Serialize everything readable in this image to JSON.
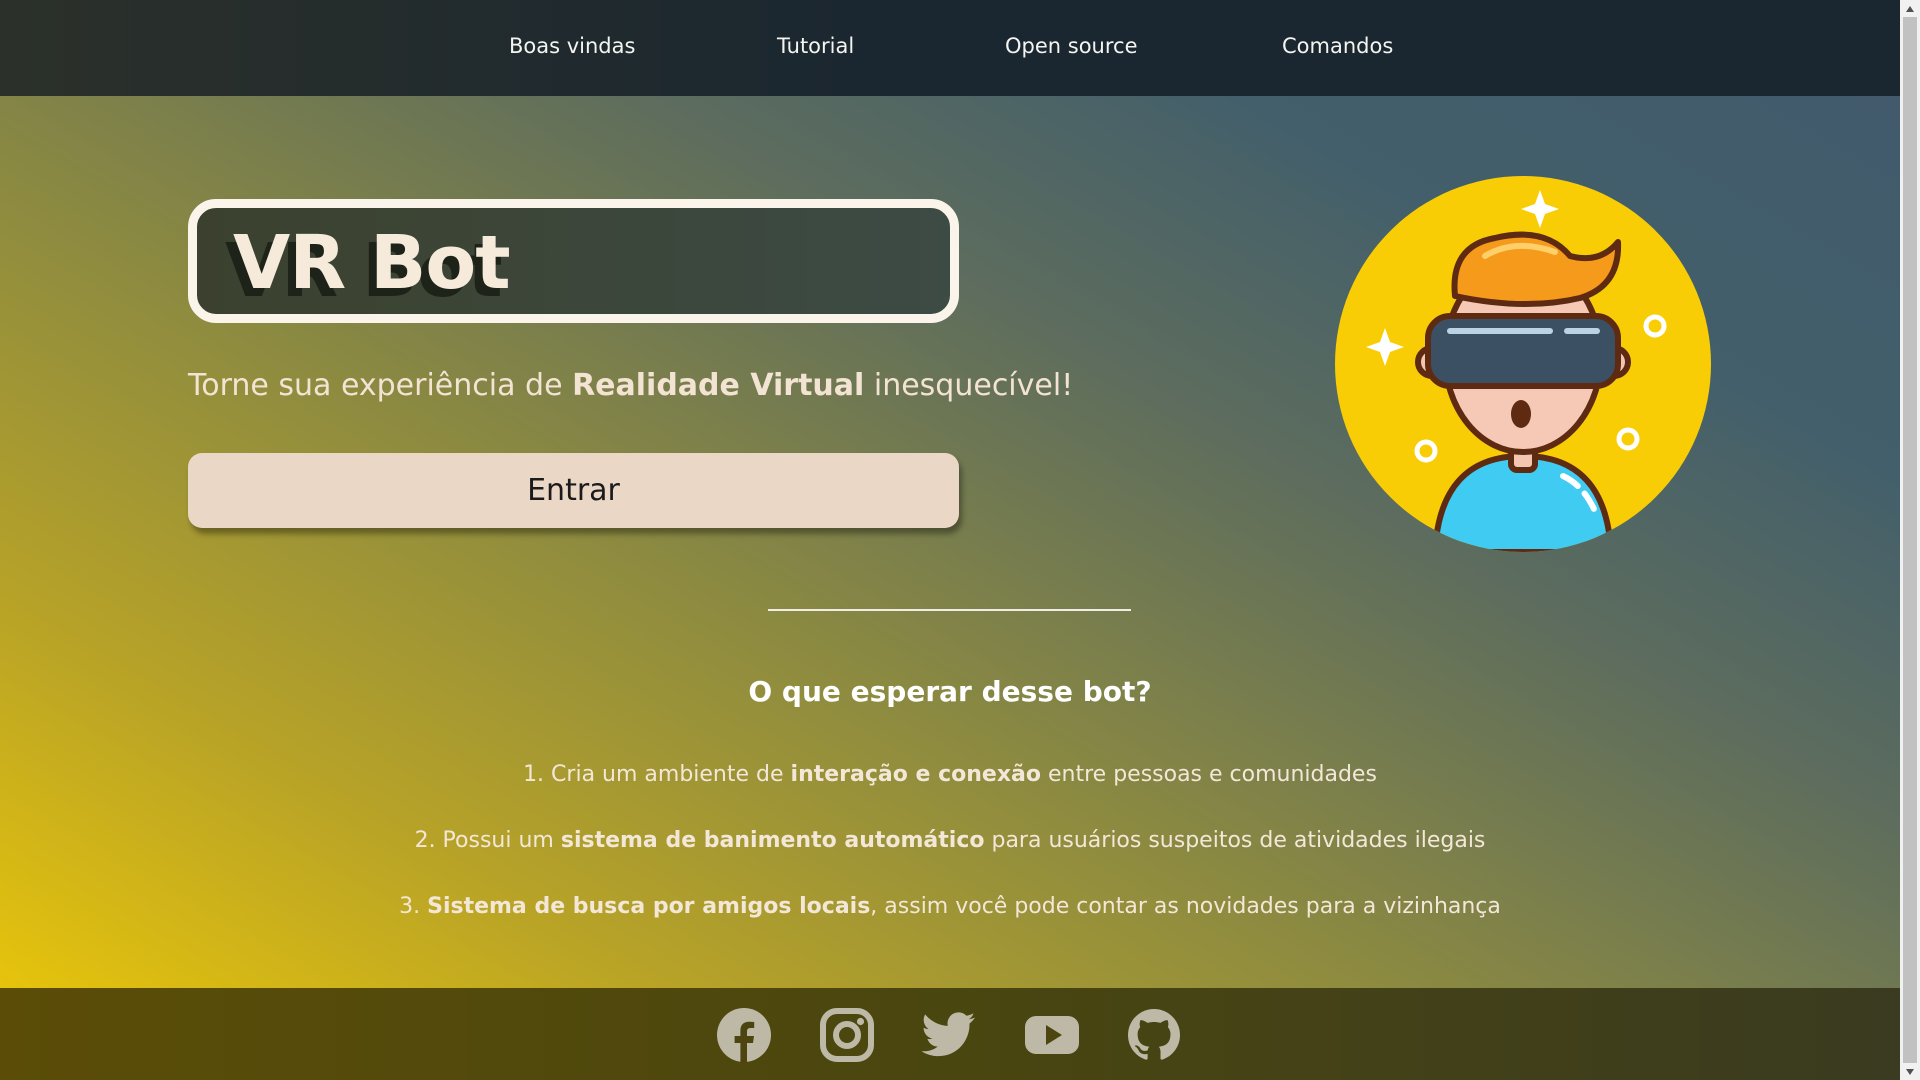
{
  "nav": {
    "items": [
      {
        "label": "Boas vindas"
      },
      {
        "label": "Tutorial"
      },
      {
        "label": "Open source"
      },
      {
        "label": "Comandos"
      }
    ]
  },
  "hero": {
    "title": "VR Bot",
    "subtitle_pre": "Torne sua experiência de ",
    "subtitle_bold": "Realidade Virtual",
    "subtitle_post": " inesquecível!",
    "button_label": "Entrar",
    "illustration_icon": "vr-headset-person-icon"
  },
  "features": {
    "title": "O que esperar desse bot?",
    "items": [
      {
        "pre": "1. Cria um ambiente de ",
        "bold": "interação e conexão",
        "post": " entre pessoas e comunidades"
      },
      {
        "pre": "2. Possui um ",
        "bold": "sistema de banimento automático",
        "post": " para usuários suspeitos de atividades ilegais"
      },
      {
        "pre": "3. ",
        "bold": "Sistema de busca por amigos locais",
        "post": ", assim você pode contar as novidades para a vizinhança"
      }
    ]
  },
  "footer": {
    "social": [
      {
        "icon": "facebook-icon"
      },
      {
        "icon": "instagram-icon"
      },
      {
        "icon": "twitter-icon"
      },
      {
        "icon": "youtube-icon"
      },
      {
        "icon": "github-icon"
      }
    ]
  },
  "colors": {
    "nav_bg": "#1b2730",
    "title_border": "#fbf4ea",
    "button_bg": "#ead7c6",
    "accent_yellow": "#f9cd06",
    "footer_bg": "#4a4610",
    "social_icon": "#bdb9a6"
  }
}
